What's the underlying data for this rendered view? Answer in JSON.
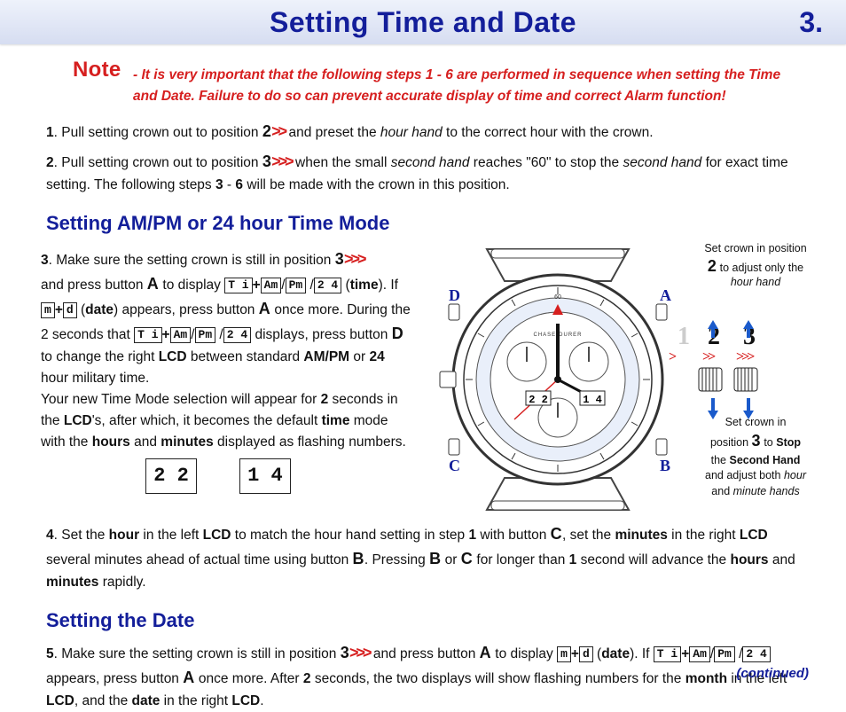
{
  "page": {
    "title": "Setting Time and Date",
    "number": "3."
  },
  "note": {
    "label": "Note",
    "body": "- It is very important that the following steps 1 - 6 are performed in sequence when setting the Time and Date.  Failure to do so can prevent accurate display of time and correct Alarm function!"
  },
  "step1": {
    "num": "1",
    "text_a": ". Pull setting crown out to position ",
    "pos": "2",
    "chev": ">>",
    "text_b": " and preset the ",
    "hourhand": "hour hand",
    "text_c": " to the correct hour with the crown."
  },
  "step2": {
    "num": "2",
    "text_a": ". Pull setting crown out to position ",
    "pos": "3",
    "chev": ">>>",
    "text_b": " when the small ",
    "sechand": "second hand",
    "text_c": " reaches \"60\" to stop the ",
    "sechand2": "second hand",
    "text_d": " for exact time setting. The following steps ",
    "r3": "3",
    "dash": " - ",
    "r6": "6",
    "text_e": " will be made with the crown in this position."
  },
  "section_ampm": "Setting AM/PM or 24 hour Time Mode",
  "step3": {
    "num": "3",
    "text_a": ". Make sure the setting crown is still in position ",
    "pos": "3",
    "chev": ">>>",
    "text_b": " and press button ",
    "btnA": "A",
    "text_c": " to display ",
    "lcd1": "T i",
    "plus1": "+",
    "lcd2": "Am",
    "sl1": "/",
    "lcd3": "Pm",
    "sl2": " /",
    "lcd4": "2 4",
    "text_d": " (",
    "time": "time",
    "text_e": "). If  ",
    "lcd5": "m",
    "plus2": "+",
    "lcd6": "d",
    "text_f": "  (",
    "date": "date",
    "text_g": ") appears, press button ",
    "btnA2": "A",
    "text_h": " once more. During the 2 seconds that ",
    "lcd7": "T i",
    "plus3": "+",
    "lcd8": "Am",
    "sl3": "/",
    "lcd9": "Pm",
    "sl4": " /",
    "lcd10": "2 4",
    "text_i": "  displays, press button ",
    "btnD": "D",
    "text_j": " to change the right ",
    "lcdw": "LCD",
    "text_k": " between standard ",
    "ampm": "AM/PM",
    "text_l": " or ",
    "h24": "24",
    "text_m": " hour military time.",
    "newline": "Your new Time Mode selection will appear for ",
    "two": "2",
    "text_n": " seconds in the ",
    "lcds": "LCD",
    "text_o": "'s, after which, it becomes the default ",
    "timew": "time",
    "text_p": " mode with the ",
    "hours": "hours",
    "text_q": " and ",
    "minutes": "minutes",
    "text_r": " displayed as flashing numbers."
  },
  "flash": {
    "a": "2 2",
    "b": "1 4"
  },
  "step4": {
    "num": "4",
    "text_a": ". Set the ",
    "hour": "hour",
    "text_b": " in the left ",
    "lcd": "LCD",
    "text_c": " to match the hour hand setting in step ",
    "one": "1",
    "text_d": " with button ",
    "btnC": "C",
    "text_e": ", set the ",
    "min": "minutes",
    "text_f": " in the right ",
    "lcd2": "LCD",
    "text_g": " several minutes ahead of actual time using button ",
    "btnB": "B",
    "text_h": ". Pressing ",
    "btnB2": "B",
    "text_i": " or ",
    "btnC2": "C",
    "text_j": " for longer than ",
    "one2": "1",
    "text_k": " second will advance the ",
    "hours": "hours",
    "text_l": " and ",
    "minutes": "minutes",
    "text_m": " rapidly."
  },
  "section_date": "Setting the Date",
  "step5": {
    "num": "5",
    "text_a": ". Make sure the setting crown is still in position ",
    "pos": "3",
    "chev": ">>>",
    "text_b": " and press button ",
    "btnA": "A",
    "text_c": " to display  ",
    "lcd1": "m",
    "plus": "+",
    "lcd2": "d",
    "text_d": " (",
    "date": "date",
    "text_e": "). If ",
    "lcd3": "T i",
    "plus2": "+",
    "lcd4": "Am",
    "sl1": "/",
    "lcd5": "Pm",
    "sl2": " /",
    "lcd6": "2 4",
    "text_f": " appears, press button ",
    "btnA2": "A",
    "text_g": " once more. After ",
    "two": "2",
    "text_h": " seconds, the two displays will show flashing numbers for the ",
    "month": "month",
    "text_i": " in the left ",
    "lcdL": "LCD",
    "text_j": ", and the ",
    "dateL": "date",
    "text_k": " in the right ",
    "lcdR": "LCD",
    "text_l": "."
  },
  "watch": {
    "brand": "CHASE-DURER",
    "lcdL": "2 2",
    "lcdR": "1 4",
    "btnA": "A",
    "btnB": "B",
    "btnC": "C",
    "btnD": "D",
    "pos1": "1",
    "pos2": "2",
    "pos3": "3",
    "chev2": ">>",
    "chev3": ">>>",
    "cap1a": "Set crown in position",
    "cap1b": " to adjust only the",
    "cap1c": "hour hand",
    "cap2a": "Set crown in",
    "cap2b": "position ",
    "cap2c": " to ",
    "cap2stop": "Stop",
    "cap2d": "the ",
    "cap2sec": "Second Hand",
    "cap2e": "and adjust both ",
    "cap2hour": "hour",
    "cap2f": "and ",
    "cap2min": "minute hands"
  },
  "continued": "(continued)"
}
